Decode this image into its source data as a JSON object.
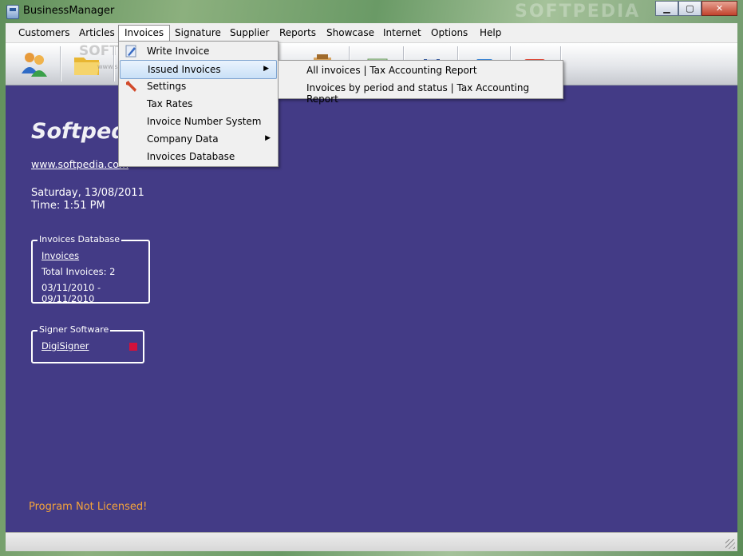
{
  "window": {
    "title": "BusinessManager",
    "watermark": "SOFTPEDIA"
  },
  "menubar": {
    "items": [
      "Customers",
      "Articles",
      "Invoices",
      "Signature",
      "Supplier",
      "Reports",
      "Showcase",
      "Internet",
      "Options",
      "Help"
    ],
    "active": "Invoices"
  },
  "invoices_menu": {
    "items": [
      {
        "label": "Write Invoice",
        "icon": "pen-icon",
        "submenu": false
      },
      {
        "label": "Issued Invoices",
        "icon": "",
        "submenu": true,
        "highlighted": true
      },
      {
        "label": "Settings",
        "icon": "wrench-icon",
        "submenu": false
      },
      {
        "label": "Tax Rates",
        "icon": "",
        "submenu": false
      },
      {
        "label": "Invoice Number System",
        "icon": "",
        "submenu": false
      },
      {
        "label": "Company Data",
        "icon": "",
        "submenu": true
      },
      {
        "label": "Invoices Database",
        "icon": "",
        "submenu": false
      }
    ]
  },
  "issued_submenu": {
    "items": [
      "All invoices | Tax Accounting Report",
      "Invoices by period and status | Tax Accounting Report"
    ]
  },
  "toolbar": {
    "buttons": [
      "customers-icon",
      "folder-icon",
      "documents-icon",
      "notes-icon",
      "chart-icon",
      "save-icon",
      "help-book-icon",
      "power-icon"
    ],
    "watermark": "SOFTPEDIA",
    "watermark_url": "www.softpedia.com"
  },
  "content": {
    "brand": "Softpedia",
    "website": "www.softpedia.com",
    "date": "Saturday, 13/08/2011",
    "time": "Time:  1:51 PM",
    "invoices_db": {
      "title": "Invoices Database",
      "link": "Invoices",
      "total": "Total Invoices:    2",
      "range": "03/11/2010 - 09/11/2010"
    },
    "signer": {
      "title": "Signer Software",
      "link": "DigiSigner",
      "status_color": "#d4113a"
    },
    "license": "Program Not Licensed!"
  },
  "colors": {
    "background": "#433b86",
    "license_text": "#f5a43a",
    "accent": "#7da2ce"
  }
}
